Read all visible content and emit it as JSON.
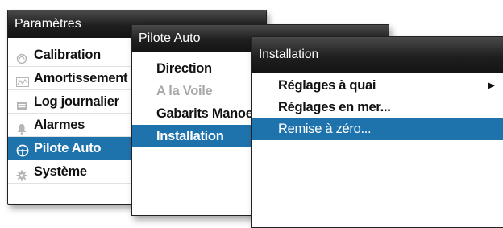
{
  "settings_menu": {
    "title": "Paramètres",
    "items": [
      {
        "label": "Calibration",
        "icon": "calibration-icon"
      },
      {
        "label": "Amortissement",
        "icon": "damping-icon"
      },
      {
        "label": "Log journalier",
        "icon": "log-icon"
      },
      {
        "label": "Alarmes",
        "icon": "bell-icon"
      },
      {
        "label": "Pilote Auto",
        "icon": "steering-wheel-icon"
      },
      {
        "label": "Système",
        "icon": "gear-icon"
      }
    ]
  },
  "autopilot_menu": {
    "title": "Pilote Auto",
    "items": [
      {
        "label": "Direction"
      },
      {
        "label": "A la Voile"
      },
      {
        "label": "Gabarits Manoe"
      },
      {
        "label": "Installation"
      }
    ]
  },
  "installation_menu": {
    "title": "Installation",
    "items": [
      {
        "label": "Réglages à quai"
      },
      {
        "label": "Réglages en mer..."
      },
      {
        "label": "Remise à zéro..."
      }
    ]
  },
  "colors": {
    "selection": "#1f73ad",
    "titlebar": "#1f1f1f",
    "disabled_text": "#a8a8a8"
  }
}
